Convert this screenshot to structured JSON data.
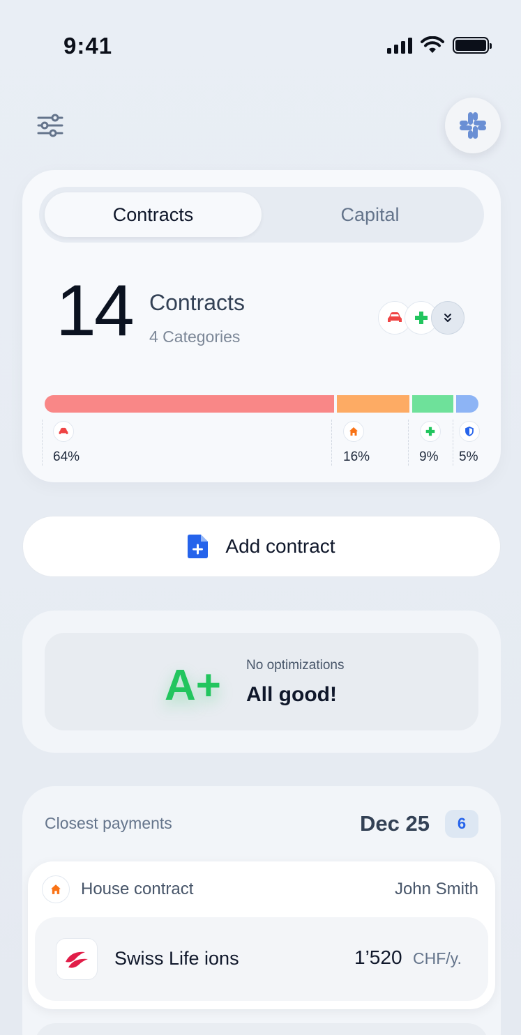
{
  "status_bar": {
    "time": "9:41"
  },
  "segment": {
    "contracts_label": "Contracts",
    "capital_label": "Capital"
  },
  "summary": {
    "count": "14",
    "label": "Contracts",
    "categories": "4 Categories",
    "distribution": [
      {
        "category": "car",
        "percent_label": "64%",
        "share": 0.64,
        "color": "#f98787",
        "icon_color": "#ef4444"
      },
      {
        "category": "home",
        "percent_label": "16%",
        "share": 0.16,
        "color": "#fdab64",
        "icon_color": "#f97316"
      },
      {
        "category": "health",
        "percent_label": "9%",
        "share": 0.09,
        "color": "#6ee19a",
        "icon_color": "#22c55e"
      },
      {
        "category": "shield",
        "percent_label": "5%",
        "share": 0.05,
        "color": "#8db4f5",
        "icon_color": "#2563eb"
      }
    ]
  },
  "add_contract": {
    "label": "Add contract"
  },
  "rating": {
    "grade": "A+",
    "subtitle": "No optimizations",
    "title": "All good!"
  },
  "payments": {
    "title": "Closest payments",
    "date": "Dec 25",
    "count_badge": "6",
    "contract": {
      "type": "House contract",
      "owner": "John Smith",
      "provider": "Swiss Life ions",
      "amount": "1’520",
      "unit": "CHF/y."
    }
  },
  "colors": {
    "accent_blue": "#2563eb",
    "good_green": "#22c55e",
    "slack_blue": "#6a8fd4"
  }
}
